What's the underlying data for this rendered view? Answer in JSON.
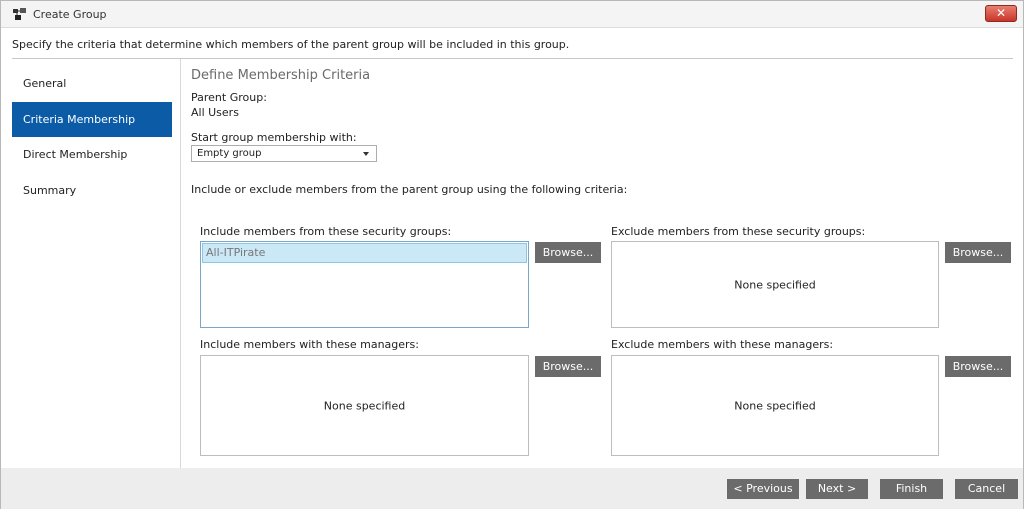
{
  "window": {
    "title": "Create Group",
    "close_label": "✕"
  },
  "instructions": "Specify the criteria that determine which members of the parent group will be included in this group.",
  "sidebar": {
    "items": [
      {
        "label": "General"
      },
      {
        "label": "Criteria Membership",
        "active": true
      },
      {
        "label": "Direct Membership"
      },
      {
        "label": "Summary"
      }
    ]
  },
  "main": {
    "section_title": "Define Membership Criteria",
    "parent_group_label": "Parent Group:",
    "parent_group_value": "All Users",
    "start_label": "Start group membership with:",
    "start_value": "Empty group",
    "criteria_text": "Include or exclude members from the parent group using the following criteria:",
    "include_groups": {
      "label": "Include members from these security groups:",
      "items": [
        "All-ITPirate"
      ]
    },
    "exclude_groups": {
      "label": "Exclude members from these security groups:",
      "empty_text": "None specified"
    },
    "include_managers": {
      "label": "Include members with these managers:",
      "empty_text": "None specified"
    },
    "exclude_managers": {
      "label": "Exclude members with these managers:",
      "empty_text": "None specified"
    },
    "browse_label": "Browse..."
  },
  "footer": {
    "previous_label": "< Previous",
    "next_label": "Next >",
    "finish_label": "Finish",
    "cancel_label": "Cancel"
  },
  "colors": {
    "active_nav": "#0b5ba7",
    "button_gray": "#6b6b6b",
    "close_red": "#c8352a",
    "selected_row": "#cbe8f6"
  },
  "icons": {
    "app": "group-icon",
    "close": "close-icon",
    "dropdown": "chevron-down-icon"
  }
}
